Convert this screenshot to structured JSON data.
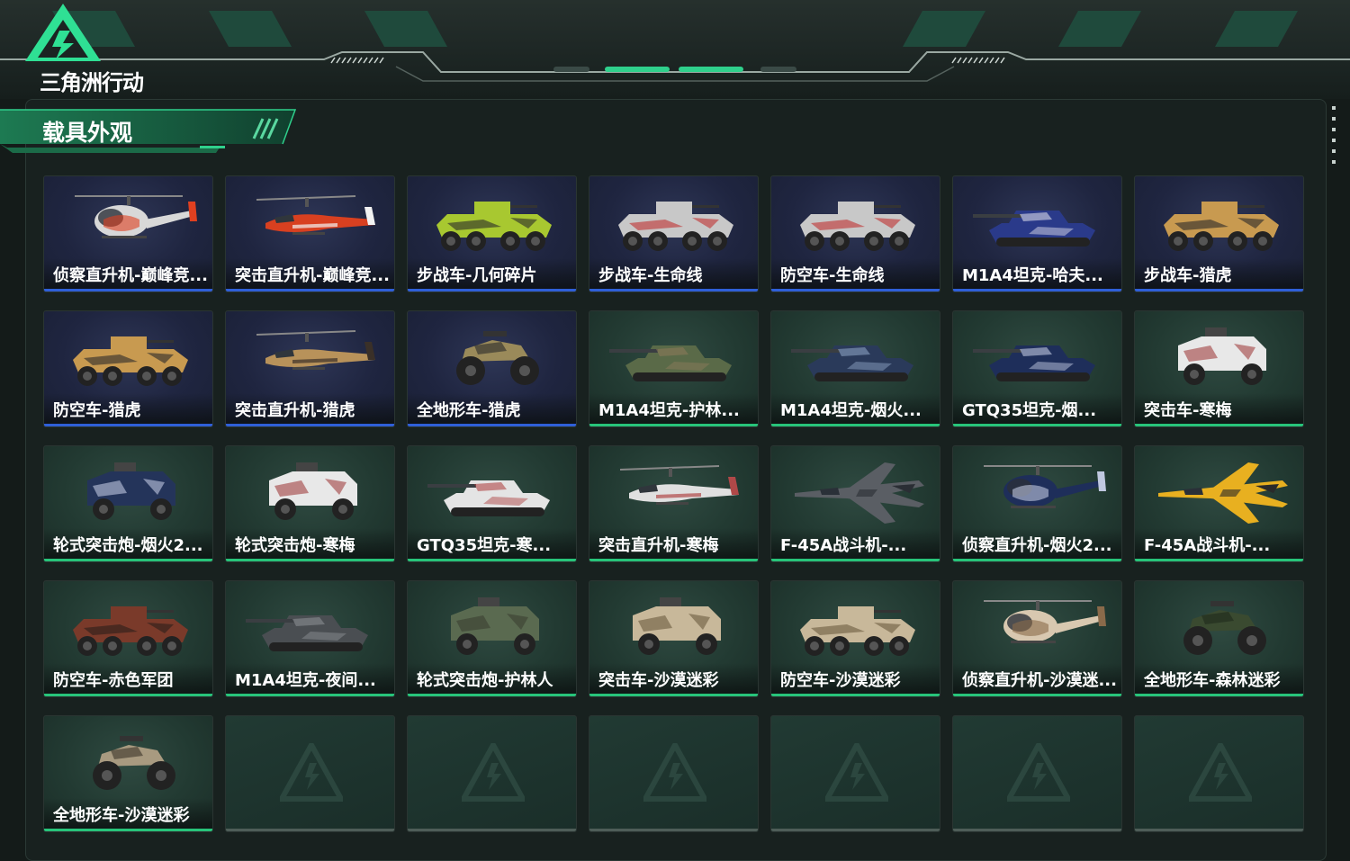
{
  "app": {
    "logo_text": "三角洲行动"
  },
  "section": {
    "title": "载具外观"
  },
  "colors": {
    "accent": "#27c47a",
    "rare_blue": "#2f5fd8",
    "empty": "#4e5d58"
  },
  "cards": [
    {
      "label": "侦察直升机-巅峰竞...",
      "tier": "blue",
      "kind": "heli",
      "color": "#d8d8d8",
      "accent": "#e04020"
    },
    {
      "label": "突击直升机-巅峰竞...",
      "tier": "blue",
      "kind": "attack",
      "color": "#d84020",
      "accent": "#f2f2f2"
    },
    {
      "label": "步战车-几何碎片",
      "tier": "blue",
      "kind": "apc",
      "color": "#a8c830",
      "accent": "#2a2a2a"
    },
    {
      "label": "步战车-生命线",
      "tier": "blue",
      "kind": "apc",
      "color": "#c8c8c8",
      "accent": "#c03030"
    },
    {
      "label": "防空车-生命线",
      "tier": "blue",
      "kind": "apc",
      "color": "#c8c8c8",
      "accent": "#c03030"
    },
    {
      "label": "M1A4坦克-哈夫...",
      "tier": "blue",
      "kind": "tank",
      "color": "#2a3a8a",
      "accent": "#d8d8e8"
    },
    {
      "label": "步战车-猎虎",
      "tier": "blue",
      "kind": "apc",
      "color": "#c89a50",
      "accent": "#2a2a2a"
    },
    {
      "label": "防空车-猎虎",
      "tier": "blue",
      "kind": "apc",
      "color": "#c89a50",
      "accent": "#2a2a2a"
    },
    {
      "label": "突击直升机-猎虎",
      "tier": "blue",
      "kind": "attack",
      "color": "#b8925a",
      "accent": "#3a3028"
    },
    {
      "label": "全地形车-猎虎",
      "tier": "blue",
      "kind": "atv",
      "color": "#9a8a5a",
      "accent": "#2a2a2a"
    },
    {
      "label": "M1A4坦克-护林...",
      "tier": "green",
      "kind": "tank",
      "color": "#5a6a48",
      "accent": "#8a7a5a"
    },
    {
      "label": "M1A4坦克-烟火...",
      "tier": "green",
      "kind": "tank",
      "color": "#2a3a5a",
      "accent": "#8aa0c0"
    },
    {
      "label": "GTQ35坦克-烟...",
      "tier": "green",
      "kind": "tank",
      "color": "#1e2e5a",
      "accent": "#c0c8e0"
    },
    {
      "label": "突击车-寒梅",
      "tier": "green",
      "kind": "truck",
      "color": "#e8e8e8",
      "accent": "#a04040"
    },
    {
      "label": "轮式突击炮-烟火2...",
      "tier": "green",
      "kind": "truck",
      "color": "#24345a",
      "accent": "#c0c8e0"
    },
    {
      "label": "轮式突击炮-寒梅",
      "tier": "green",
      "kind": "truck",
      "color": "#e8e8e8",
      "accent": "#a04040"
    },
    {
      "label": "GTQ35坦克-寒...",
      "tier": "green",
      "kind": "tank",
      "color": "#e4e4e4",
      "accent": "#b04848"
    },
    {
      "label": "突击直升机-寒梅",
      "tier": "green",
      "kind": "attack",
      "color": "#e0e0e0",
      "accent": "#b04848"
    },
    {
      "label": "F-45A战斗机-...",
      "tier": "green",
      "kind": "jet",
      "color": "#5a5e64",
      "accent": "#2a2e34"
    },
    {
      "label": "侦察直升机-烟火2...",
      "tier": "green",
      "kind": "heli",
      "color": "#1e2e5a",
      "accent": "#c0c8e0"
    },
    {
      "label": "F-45A战斗机-...",
      "tier": "green",
      "kind": "jet",
      "color": "#e8b020",
      "accent": "#2a2a2a"
    },
    {
      "label": "防空车-赤色军团",
      "tier": "green",
      "kind": "apc",
      "color": "#7a3a2a",
      "accent": "#2a1e1a"
    },
    {
      "label": "M1A4坦克-夜间...",
      "tier": "green",
      "kind": "tank",
      "color": "#4a4e52",
      "accent": "#8a8e92"
    },
    {
      "label": "轮式突击炮-护林人",
      "tier": "green",
      "kind": "truck",
      "color": "#5a6a50",
      "accent": "#3a4030"
    },
    {
      "label": "突击车-沙漠迷彩",
      "tier": "green",
      "kind": "truck",
      "color": "#c8b89a",
      "accent": "#6a5a40"
    },
    {
      "label": "防空车-沙漠迷彩",
      "tier": "green",
      "kind": "apc",
      "color": "#c8b89a",
      "accent": "#6a5a40"
    },
    {
      "label": "侦察直升机-沙漠迷...",
      "tier": "green",
      "kind": "heli",
      "color": "#d8c8b0",
      "accent": "#8a6a4a"
    },
    {
      "label": "全地形车-森林迷彩",
      "tier": "green",
      "kind": "atv",
      "color": "#3a4a30",
      "accent": "#1e2a1a"
    },
    {
      "label": "全地形车-沙漠迷彩",
      "tier": "green",
      "kind": "atv",
      "color": "#a89a80",
      "accent": "#3a3428"
    },
    {
      "label": "",
      "tier": "empty"
    },
    {
      "label": "",
      "tier": "empty"
    },
    {
      "label": "",
      "tier": "empty"
    },
    {
      "label": "",
      "tier": "empty"
    },
    {
      "label": "",
      "tier": "empty"
    },
    {
      "label": "",
      "tier": "empty"
    }
  ]
}
